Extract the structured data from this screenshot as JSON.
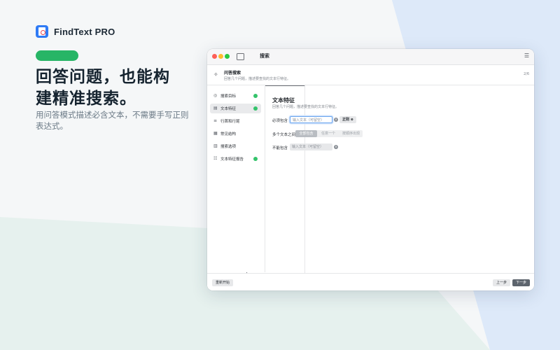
{
  "brand": {
    "name": "FindText PRO"
  },
  "marketing": {
    "headline_line1": "回答问题，也能构",
    "headline_line2": "建精准搜索。",
    "subline": "用问答模式描述必含文本，不需要手写正则表达式。"
  },
  "window": {
    "title": "搜索",
    "banner": {
      "title": "问答搜索",
      "subtitle": "回答几个问题，描述要查找的文本行特征。",
      "right": "2/6"
    },
    "sidebar": {
      "items": [
        {
          "label": "搜索目标",
          "icon": "target-icon",
          "done": true,
          "active": false
        },
        {
          "label": "文本特征",
          "icon": "text-icon",
          "done": true,
          "active": true
        },
        {
          "label": "行首和行尾",
          "icon": "line-icon",
          "done": false,
          "active": false
        },
        {
          "label": "常见结构",
          "icon": "structure-icon",
          "done": false,
          "active": false
        },
        {
          "label": "搜索选项",
          "icon": "options-icon",
          "done": false,
          "active": false
        },
        {
          "label": "文本特征报告",
          "icon": "report-icon",
          "done": true,
          "active": false
        }
      ]
    },
    "main": {
      "title": "文本特征",
      "subtitle": "回答几个问题，描述要查找的文本行特征。",
      "must_contain": {
        "label": "必须包含",
        "placeholder": "输入文本（可留空）",
        "regex_label": "正则"
      },
      "relation": {
        "label": "多个文本之间",
        "options": [
          "全部包含",
          "任意一个",
          "按顺序出现"
        ],
        "selected": 0
      },
      "must_not": {
        "label": "不能包含",
        "placeholder": "输入文本（可留空）"
      }
    },
    "footer": {
      "restart": "重新开始",
      "prev": "上一步",
      "next": "下一步"
    }
  }
}
